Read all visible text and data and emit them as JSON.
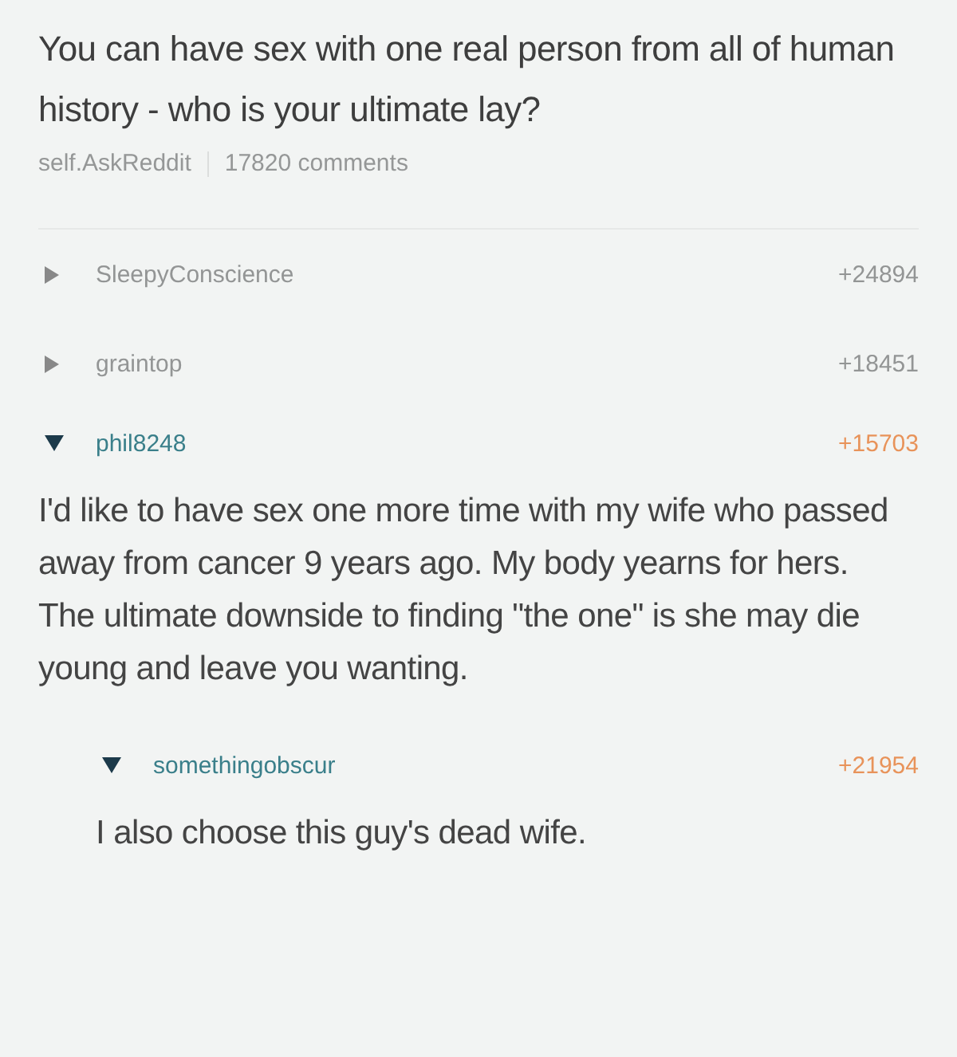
{
  "post": {
    "title": "You can have sex with one real person from all of human history - who is your ultimate lay?",
    "subreddit": "self.AskReddit",
    "comments_count": "17820 comments"
  },
  "comments": [
    {
      "author": "SleepyConscience",
      "score": "+24894",
      "expanded": false
    },
    {
      "author": "graintop",
      "score": "+18451",
      "expanded": false
    },
    {
      "author": "phil8248",
      "score": "+15703",
      "expanded": true,
      "body": "I'd like to have sex one more time with my wife who passed away from cancer 9 years ago. My body yearns for hers.  The ultimate downside to finding \"the one\" is she may die young and leave you wanting.",
      "children": [
        {
          "author": "somethingobscur",
          "score": "+21954",
          "expanded": true,
          "body": "I also choose this guy's dead wife."
        }
      ]
    }
  ]
}
